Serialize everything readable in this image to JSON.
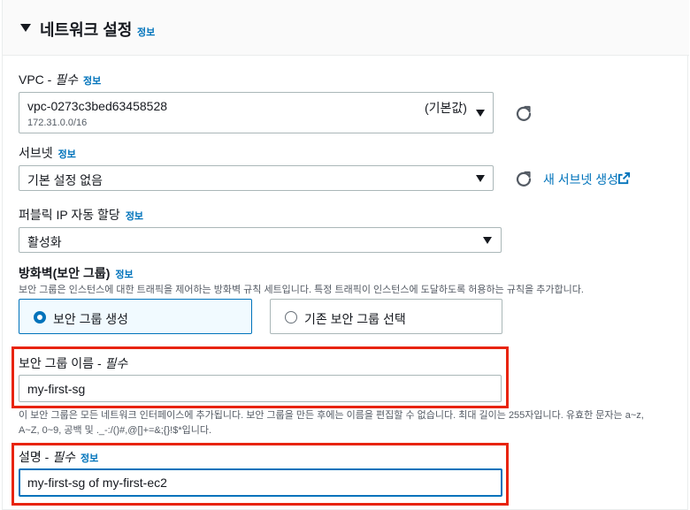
{
  "header": {
    "title": "네트워크 설정",
    "info": "정보"
  },
  "vpc": {
    "label": "VPC - ",
    "required": "필수",
    "info": "정보",
    "value": "vpc-0273c3bed63458528",
    "sub": "172.31.0.0/16",
    "default_tag": "(기본값)"
  },
  "subnet": {
    "label": "서브넷",
    "info": "정보",
    "value": "기본 설정 없음",
    "create_link": "새 서브넷 생성"
  },
  "public_ip": {
    "label": "퍼블릭 IP 자동 할당",
    "info": "정보",
    "value": "활성화"
  },
  "firewall": {
    "label": "방화벽(보안 그룹)",
    "info": "정보",
    "description": "보안 그룹은 인스턴스에 대한 트래픽을 제어하는 방화벽 규칙 세트입니다. 특정 트래픽이 인스턴스에 도달하도록 허용하는 규칙을 추가합니다.",
    "options": [
      {
        "label": "보안 그룹 생성",
        "selected": true
      },
      {
        "label": "기존 보안 그룹 선택",
        "selected": false
      }
    ]
  },
  "sg_name": {
    "label": "보안 그룹 이름 - ",
    "required": "필수",
    "value": "my-first-sg",
    "help_line1": "이 보안 그룹은 모든 네트워크 인터페이스에 추가됩니다. 보안 그룹을 만든 후에는 이름을 편집할 수 없습니다. 최대 길이는 255자입니다. 유효한 문자는 a~z,",
    "help_line2": "A~Z, 0~9, 공백 및 ._-:/()#,@[]+=&;{}!$*입니다."
  },
  "description": {
    "label": "설명 - ",
    "required": "필수",
    "info": "정보",
    "value": "my-first-sg of my-first-ec2"
  },
  "colors": {
    "accent": "#0073bb",
    "highlight": "#e8240e"
  }
}
